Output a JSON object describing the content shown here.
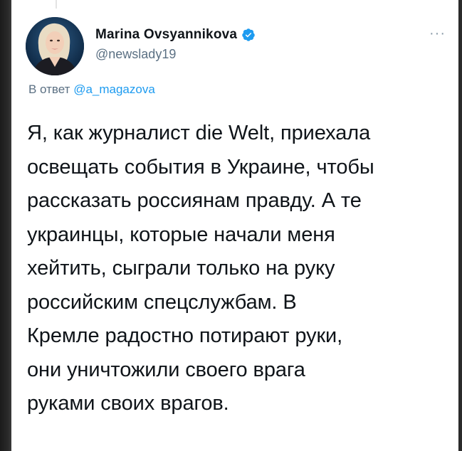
{
  "author": {
    "display_name": "Marina Ovsyannikova",
    "handle": "@newslady19",
    "verified": true,
    "avatar": "avatar-photo"
  },
  "reply": {
    "prefix": "В ответ",
    "mention": "@a_magazova"
  },
  "tweet": {
    "lines": [
      "Я, как журналист die Welt, приехала",
      "освещать события в Украине, чтобы",
      "рассказать россиянам правду. А те",
      "украинцы, которые начали меня",
      "хейтить, сыграли только на руку",
      "российским спецслужбам. В",
      "Кремле радостно потирают руки,",
      "они уничтожили своего врага",
      "руками своих врагов."
    ]
  },
  "icons": {
    "verified": "verified-badge-icon",
    "more": "more-options-icon"
  },
  "colors": {
    "verified": "#1d9bf0",
    "mention": "#1d9bf0",
    "secondary_text": "#5b7083",
    "primary_text": "#0f1419"
  }
}
